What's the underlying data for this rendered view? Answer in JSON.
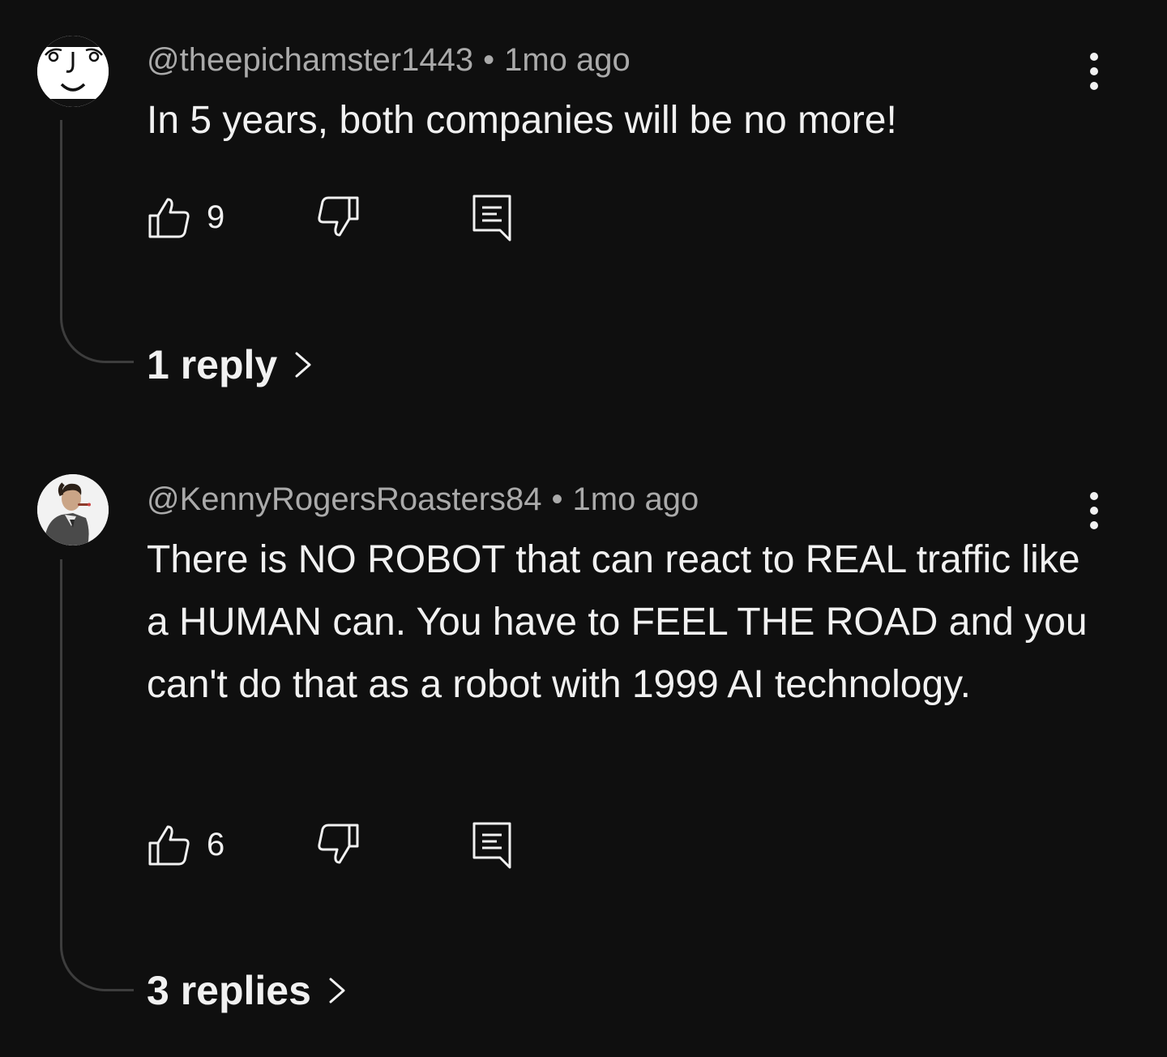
{
  "comments": [
    {
      "handle": "@theepichamster1443",
      "separator": "•",
      "time": "1mo ago",
      "text": "In 5 years, both companies will be no more!",
      "likes": "9",
      "replies_label": "1 reply",
      "avatar_icon": "lenny-face-avatar"
    },
    {
      "handle": "@KennyRogersRoasters84",
      "separator": "•",
      "time": "1mo ago",
      "text": "There is NO ROBOT that can react to REAL traffic like a HUMAN can. You have to FEEL THE ROAD and you can't do that as a robot with 1999 AI technology.",
      "likes": "6",
      "replies_label": "3 replies",
      "avatar_icon": "man-with-cigar-avatar"
    }
  ],
  "icons": {
    "like": "thumbs-up-icon",
    "dislike": "thumbs-down-icon",
    "reply": "comment-reply-icon",
    "more": "more-vertical-icon",
    "chevron": "chevron-right-icon"
  },
  "colors": {
    "background": "#0f0f0f",
    "text_primary": "#f1f1f1",
    "text_secondary": "#aaaaaa",
    "thread_line": "#3d3d3d"
  }
}
